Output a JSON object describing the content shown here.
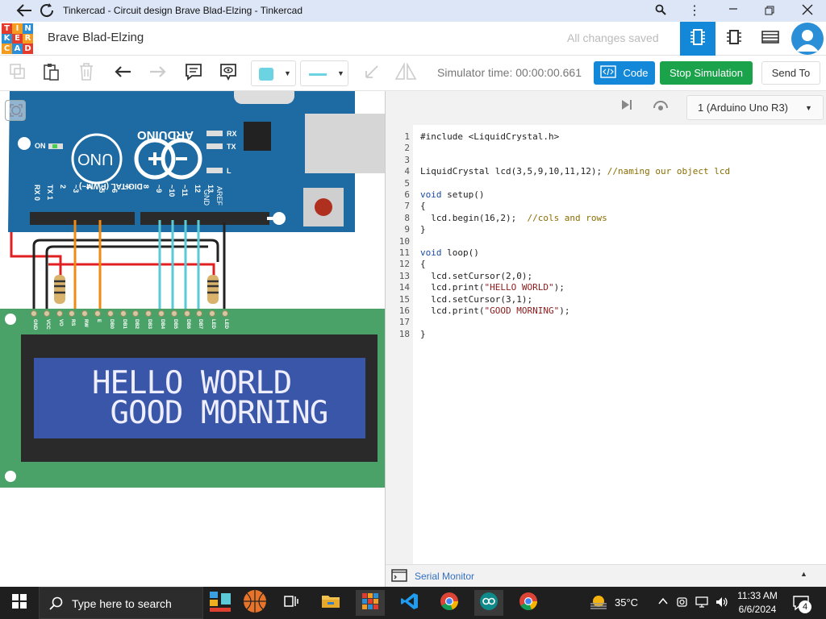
{
  "window": {
    "title": "Tinkercad - Circuit design Brave Blad-Elzing - Tinkercad"
  },
  "header": {
    "logo_letters": [
      "T",
      "I",
      "N",
      "K",
      "E",
      "R",
      "C",
      "A",
      "D"
    ],
    "design_name": "Brave Blad-Elzing",
    "save_status": "All changes saved"
  },
  "toolbar": {
    "simulator_time": "Simulator time: 00:00:00.661",
    "code_label": "Code",
    "stop_label": "Stop Simulation",
    "send_label": "Send To"
  },
  "code_panel": {
    "device": "1 (Arduino Uno R3)",
    "serial_monitor": "Serial Monitor",
    "lines": [
      {
        "n": "1",
        "t": "#include <LiquidCrystal.h>"
      },
      {
        "n": "2",
        "t": ""
      },
      {
        "n": "3",
        "t": ""
      },
      {
        "n": "4",
        "t": "LiquidCrystal lcd(3,5,9,10,11,12); //naming our object lcd"
      },
      {
        "n": "5",
        "t": ""
      },
      {
        "n": "6",
        "t": "void setup()"
      },
      {
        "n": "7",
        "t": "{"
      },
      {
        "n": "8",
        "t": "  lcd.begin(16,2);  //cols and rows"
      },
      {
        "n": "9",
        "t": "}"
      },
      {
        "n": "10",
        "t": ""
      },
      {
        "n": "11",
        "t": "void loop()"
      },
      {
        "n": "12",
        "t": "{"
      },
      {
        "n": "13",
        "t": "  lcd.setCursor(2,0);"
      },
      {
        "n": "14",
        "t": "  lcd.print(\"HELLO WORLD\");"
      },
      {
        "n": "15",
        "t": "  lcd.setCursor(3,1);"
      },
      {
        "n": "16",
        "t": "  lcd.print(\"GOOD MORNING\");"
      },
      {
        "n": "17",
        "t": ""
      },
      {
        "n": "18",
        "t": "}"
      }
    ]
  },
  "circuit": {
    "board_brand": "ARDUINO",
    "board_model": "UNO",
    "on_label": "ON",
    "rx_label": "RX",
    "tx_label": "TX",
    "l_label": "L",
    "digital_label": "DIGITAL (PWM~)",
    "aref_label": "AREF",
    "gnd_label": "GND",
    "pin_labels": [
      "RX 0",
      "TX 1",
      "2",
      "~3",
      "4",
      "~5",
      "~6",
      "7",
      "8",
      "~9",
      "~10",
      "~11",
      "12",
      "13"
    ],
    "lcd_pins": [
      "GND",
      "VCC",
      "VO",
      "RS",
      "RW",
      "E",
      "DB0",
      "DB1",
      "DB2",
      "DB3",
      "DB4",
      "DB5",
      "DB6",
      "DB7",
      "LED",
      "LED"
    ],
    "lcd_line1": "HELLO WORLD",
    "lcd_line2": " GOOD MORNING"
  },
  "taskbar": {
    "search_placeholder": "Type here to search",
    "temperature": "35°C",
    "time": "11:33 AM",
    "date": "6/6/2024",
    "notifications": "4"
  },
  "colors": {
    "arduino_blue": "#1e6ba3",
    "lcd_green": "#4aa269",
    "lcd_screen": "#3a56a8",
    "code_button": "#1488d8",
    "stop_button": "#1aa34a"
  }
}
